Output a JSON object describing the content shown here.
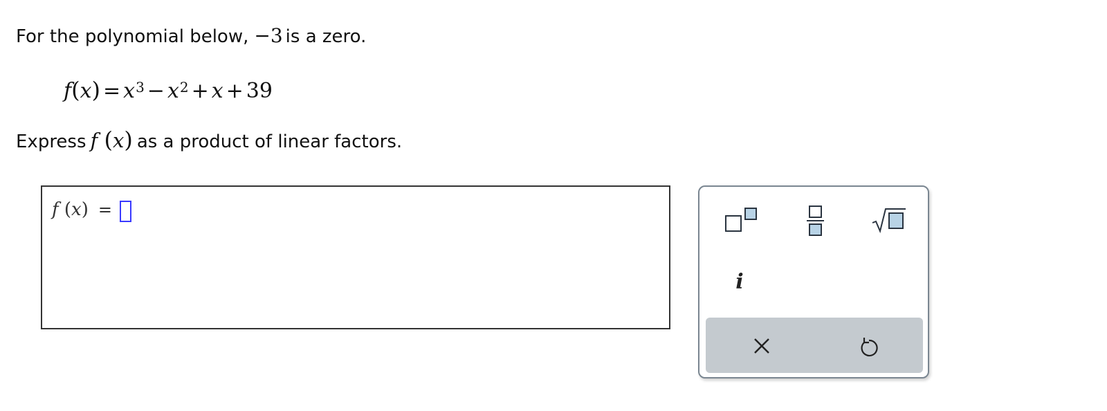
{
  "prompt": {
    "before": "For the polynomial below,",
    "zero": "−3",
    "after": "is a zero."
  },
  "polynomial": {
    "f": "f",
    "var": "x",
    "equals": "=",
    "term1_base": "x",
    "term1_exp": "3",
    "minus": "−",
    "term2_base": "x",
    "term2_exp": "2",
    "plus1": "+",
    "term3": "x",
    "plus2": "+",
    "constant": "39"
  },
  "instruction": {
    "before": "Express",
    "f": "f",
    "var": "x",
    "after": "as a product of linear factors."
  },
  "answer": {
    "f": "f",
    "var": "x",
    "equals": "="
  },
  "palette": {
    "imaginary_label": "i",
    "icons": {
      "superscript": "superscript-template-icon",
      "fraction": "fraction-template-icon",
      "sqrt": "square-root-template-icon",
      "clear": "close-icon",
      "undo": "undo-icon"
    },
    "colors": {
      "slot_fill": "#b8d3e6",
      "slot_stroke": "#2a3440",
      "active_slot_border": "#3a3aff",
      "action_bar": "#c4cacf"
    }
  }
}
